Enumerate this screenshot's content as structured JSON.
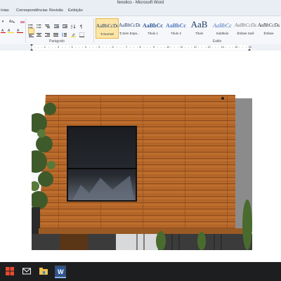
{
  "window": {
    "title": "fenolico - Microsoft Word"
  },
  "tabs": [
    "ínias",
    "Correspondências",
    "Revisão",
    "Exibição"
  ],
  "ribbon": {
    "groups": {
      "paragraph": "Parágrafo",
      "style": "Estilo"
    },
    "font_size_label": "Aa",
    "styles": [
      {
        "sample": "AaBbCcDd",
        "label": "¶ Normal"
      },
      {
        "sample": "AaBbCcDd",
        "label": "¶ Sem Espa..."
      },
      {
        "sample": "AaBbCc",
        "label": "Título 1"
      },
      {
        "sample": "AaBbCc",
        "label": "Título 2"
      },
      {
        "sample": "AaB",
        "label": "Título"
      },
      {
        "sample": "AaBbCc",
        "label": "Subtítulo"
      },
      {
        "sample": "AaBbCcDd",
        "label": "Ênfase Sutil"
      },
      {
        "sample": "AaBbCcDd",
        "label": "Ênfase"
      }
    ]
  },
  "ruler": {
    "numbers": [
      "1",
      "2",
      "3",
      "4",
      "5",
      "6",
      "7",
      "8",
      "9",
      "10",
      "11",
      "12",
      "13",
      "14",
      "15",
      "16"
    ]
  },
  "colors": {
    "accent_highlight": "#fbe6a8",
    "taskbar": "#1d1e1f",
    "wood": "#b8692a"
  },
  "taskbar": {
    "items": [
      "windows-logo-icon",
      "mail-icon",
      "file-explorer-icon",
      "word-icon"
    ]
  }
}
